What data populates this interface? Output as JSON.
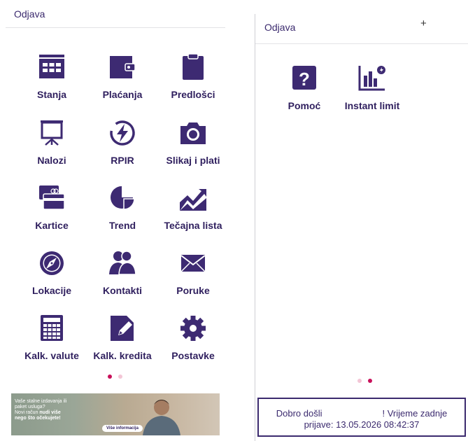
{
  "left": {
    "logout": "Odjava",
    "tiles": [
      {
        "label": "Stanja",
        "icon": "account-balance-icon"
      },
      {
        "label": "Plaćanja",
        "icon": "wallet-icon"
      },
      {
        "label": "Predlošci",
        "icon": "clipboard-icon"
      },
      {
        "label": "Nalozi",
        "icon": "presentation-board-icon"
      },
      {
        "label": "RPIR",
        "icon": "lightning-icon"
      },
      {
        "label": "Slikaj i plati",
        "icon": "camera-icon"
      },
      {
        "label": "Kartice",
        "icon": "cards-icon"
      },
      {
        "label": "Trend",
        "icon": "pie-chart-icon"
      },
      {
        "label": "Tečajna lista",
        "icon": "line-chart-icon"
      },
      {
        "label": "Lokacije",
        "icon": "compass-icon"
      },
      {
        "label": "Kontakti",
        "icon": "people-icon"
      },
      {
        "label": "Poruke",
        "icon": "envelope-icon"
      },
      {
        "label": "Kalk. valute",
        "icon": "calculator-icon"
      },
      {
        "label": "Kalk. kredita",
        "icon": "edit-icon"
      },
      {
        "label": "Postavke",
        "icon": "gear-icon"
      }
    ],
    "page_indicator": {
      "pages": 2,
      "current": 1
    },
    "banner": {
      "line1": "Vaše stalne izdavanja ili",
      "line2": "paket usluga?",
      "line3a": "Novi račun ",
      "line3b": "nudi više",
      "line4": "nego što očekujete!",
      "cta": "Više informacija"
    }
  },
  "right": {
    "logout": "Odjava",
    "plus": "+",
    "tiles": [
      {
        "label": "Pomoć",
        "icon": "help-icon"
      },
      {
        "label": "Instant limit",
        "icon": "instant-limit-chart-icon"
      }
    ],
    "page_indicator": {
      "pages": 2,
      "current": 2
    },
    "welcome": {
      "greeting": "Dobro došli",
      "suffix": "! Vrijeme zadnje",
      "login_label": "prijave:",
      "login_time": "13.05.2026 08:42:37"
    }
  },
  "colors": {
    "primary": "#3b2a6e",
    "icon": "#3d2a72",
    "accent": "#c8105a",
    "accent_light": "#f3c6d6"
  }
}
